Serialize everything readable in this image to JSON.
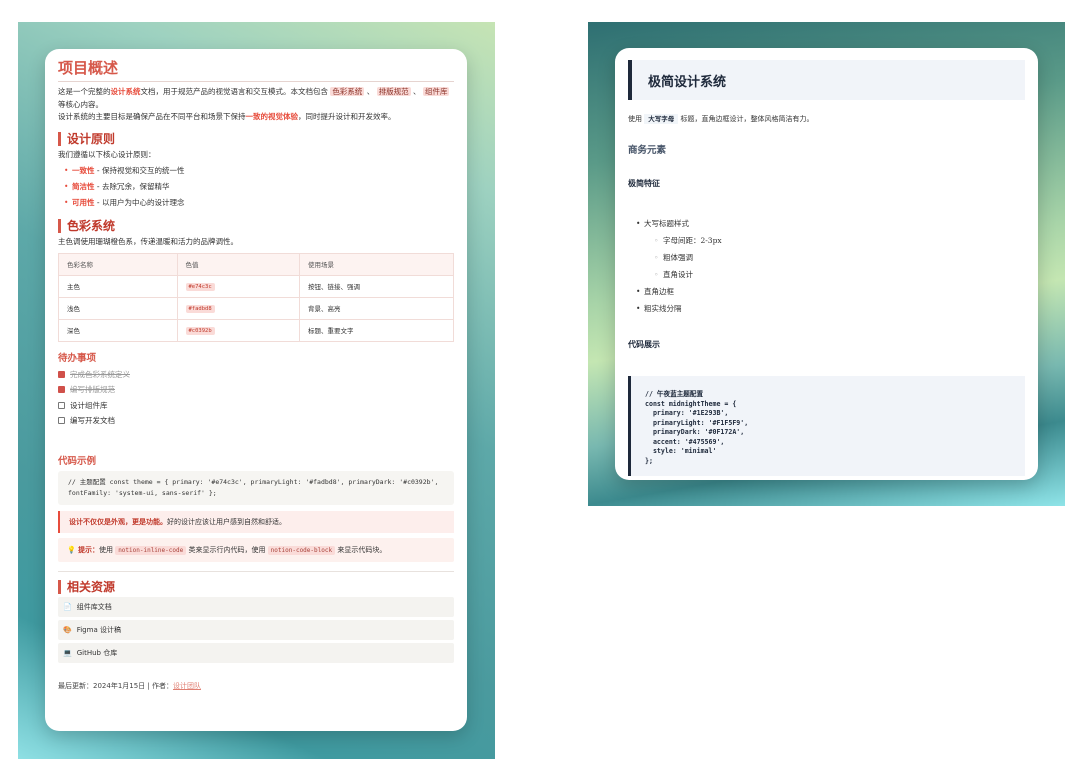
{
  "left": {
    "title": "项目概述",
    "intro": {
      "p1_a": "这是一个完整的",
      "p1_hl": "设计系统",
      "p1_b": "文档，用于规范产品的视觉语言和交互模式。本文档包含 ",
      "tag1": "色彩系统",
      "sep1": " 、 ",
      "tag2": "排版规范",
      "sep2": " 、 ",
      "tag3": "组件库",
      "p1_c": " 等核心内容。",
      "p2_a": "设计系统的主要目标是确保产品在不同平台和场景下保持",
      "p2_hl": "一致的视觉体验",
      "p2_b": "，同时提升设计和开发效率。"
    },
    "principles": {
      "heading": "设计原则",
      "lead": "我们遵循以下核心设计原则：",
      "items": [
        {
          "key": "一致性",
          "desc": " - 保持视觉和交互的统一性"
        },
        {
          "key": "简洁性",
          "desc": " - 去除冗余，保留精华"
        },
        {
          "key": "可用性",
          "desc": " - 以用户为中心的设计理念"
        }
      ]
    },
    "colors": {
      "heading": "色彩系统",
      "lead": "主色调使用珊瑚橙色系，传递温暖和活力的品牌调性。",
      "headers": [
        "色彩名称",
        "色值",
        "使用场景"
      ],
      "rows": [
        {
          "name": "主色",
          "value": "#e74c3c",
          "usage": "按钮、链接、强调"
        },
        {
          "name": "浅色",
          "value": "#fadbd8",
          "usage": "背景、高亮"
        },
        {
          "name": "深色",
          "value": "#c0392b",
          "usage": "标题、重要文字"
        }
      ]
    },
    "todo": {
      "heading": "待办事项",
      "items": [
        {
          "text": "完成色彩系统定义",
          "done": true
        },
        {
          "text": "编写排版规范",
          "done": true
        },
        {
          "text": "设计组件库",
          "done": false
        },
        {
          "text": "编写开发文档",
          "done": false
        }
      ]
    },
    "code": {
      "heading": "代码示例",
      "text": "// 主题配置 const theme = { primary: '#e74c3c', primaryLight: '#fadbd8', primaryDark: '#c0392b', fontFamily: 'system-ui, sans-serif' };"
    },
    "quote": {
      "strong": "设计不仅仅是外观，更是功能。",
      "rest": "好的设计应该让用户感到自然和舒适。"
    },
    "tip": {
      "icon": "💡",
      "label": "提示：",
      "a": "使用 ",
      "code1": "notion-inline-code",
      "b": " 类来显示行内代码，使用 ",
      "code2": "notion-code-block",
      "c": " 来显示代码块。"
    },
    "resources": {
      "heading": "相关资源",
      "items": [
        {
          "icon": "📄",
          "label": "组件库文档"
        },
        {
          "icon": "🎨",
          "label": "Figma 设计稿"
        },
        {
          "icon": "💻",
          "label": "GitHub 仓库"
        }
      ]
    },
    "footer": {
      "text": "最后更新：2024年1月15日 | 作者：",
      "link": "设计团队"
    }
  },
  "right": {
    "title": "极简设计系统",
    "para_a": "使用 ",
    "para_kw": "大写字母",
    "para_b": " 标题，直角边框设计，整体风格简洁有力。",
    "h2": "商务元素",
    "h3": "极简特征",
    "list": {
      "item1": "大写标题样式",
      "sub": [
        "字母间距：2-3px",
        "粗体强调",
        "直角设计"
      ],
      "item2": "直角边框",
      "item3": "粗实线分隔"
    },
    "h4": "代码展示",
    "code": "// 午夜蓝主题配置\nconst midnightTheme = {\n  primary: '#1E293B',\n  primaryLight: '#F1F5F9',\n  primaryDark: '#0F172A',\n  accent: '#475569',\n  style: 'minimal'\n};"
  }
}
